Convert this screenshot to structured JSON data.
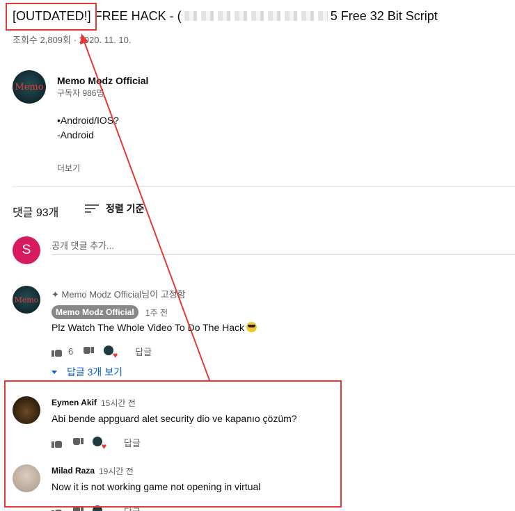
{
  "video": {
    "title_start": "[OUTDATED!] FREE HACK - (",
    "title_end": "5 Free 32 Bit Script",
    "views": "조회수 2,809회",
    "date": "2020. 11. 10."
  },
  "channel": {
    "avatar_text": "Memo",
    "name": "Memo Modz Official",
    "subscribers": "구독자 986명"
  },
  "description": {
    "line1": "•Android/IOS?",
    "line2": "-Android",
    "more_label": "더보기"
  },
  "comments_header": {
    "count_label": "댓글 93개",
    "sort_label": "정렬 기준"
  },
  "add_comment": {
    "avatar_letter": "S",
    "placeholder": "공개 댓글 추가..."
  },
  "pinned_comment": {
    "avatar_text": "Memo",
    "pinned_label": "Memo Modz Official님이 고정함",
    "author": "Memo Modz Official",
    "time": "1주 전",
    "text": "Plz Watch The Whole Video To Do The Hack",
    "likes": "6",
    "reply_label": "답글",
    "view_replies_label": "답글 3개 보기"
  },
  "replies": [
    {
      "author": "Eymen Akif",
      "time": "15시간 전",
      "text": "Abi bende appguard alet security dio ve kapanıo çözüm?",
      "reply_label": "답글"
    },
    {
      "author": "Milad Raza",
      "time": "19시간 전",
      "text": "Now it is not working game not opening in virtual",
      "reply_label": "답글"
    }
  ],
  "colors": {
    "annotation_red": "#e53935",
    "link_blue": "#065fd4",
    "add_avatar_bg": "#d81b60"
  }
}
